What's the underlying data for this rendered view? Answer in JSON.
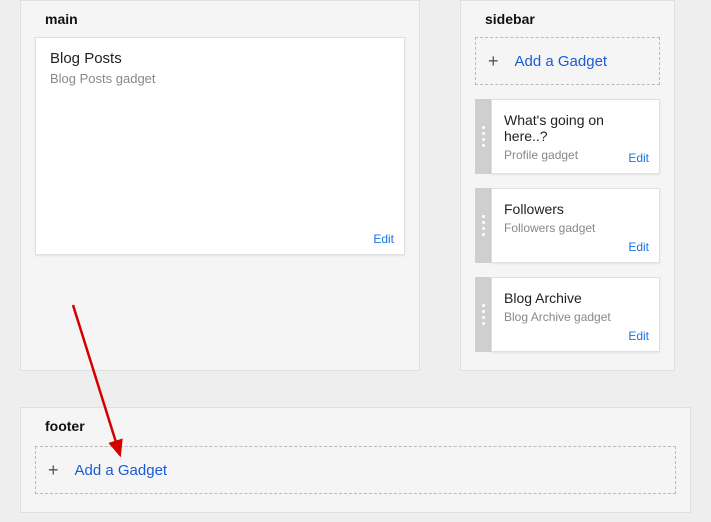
{
  "main": {
    "title": "main",
    "card": {
      "title": "Blog Posts",
      "sub": "Blog Posts gadget",
      "edit": "Edit"
    }
  },
  "sidebar": {
    "title": "sidebar",
    "add_label": "Add a Gadget",
    "gadgets": [
      {
        "title": "What's going on here..?",
        "sub": "Profile gadget",
        "edit": "Edit"
      },
      {
        "title": "Followers",
        "sub": "Followers gadget",
        "edit": "Edit"
      },
      {
        "title": "Blog Archive",
        "sub": "Blog Archive gadget",
        "edit": "Edit"
      }
    ]
  },
  "footer": {
    "title": "footer",
    "add_label": "Add a Gadget"
  }
}
